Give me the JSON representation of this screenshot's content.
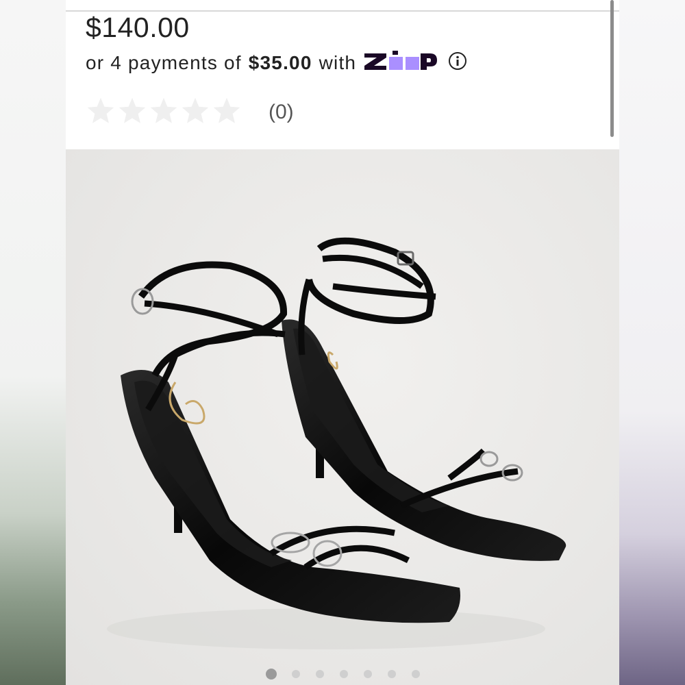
{
  "product": {
    "price": "$140.00",
    "installment": {
      "prefix": "or 4 payments of",
      "amount": "$35.00",
      "suffix": "with",
      "provider": "zip",
      "info_icon": "info-circle-icon"
    },
    "rating": {
      "stars_filled": 0,
      "stars_total": 5,
      "review_count": "(0)"
    },
    "image": {
      "alt": "product-photo-black-strappy-heeled-sandals",
      "current_index": 1,
      "total": 7
    }
  },
  "colors": {
    "zip_brand": "#1a0826",
    "zip_accent": "#aa8fff",
    "star_empty": "#efefef",
    "dot_active": "#9a9a9a",
    "dot_inactive": "#cfcfcf"
  }
}
